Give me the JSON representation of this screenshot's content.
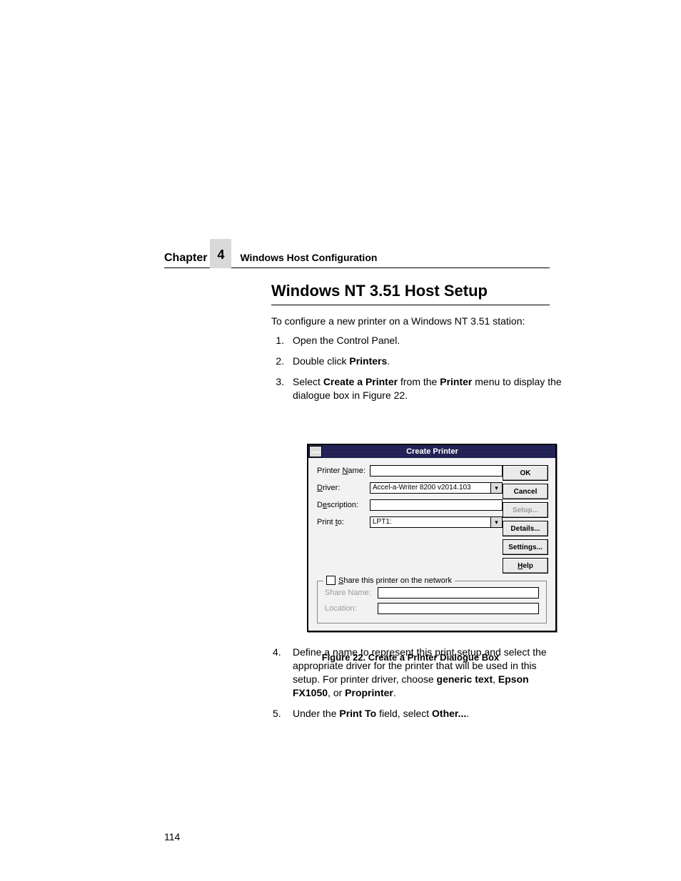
{
  "header": {
    "chapter_label": "Chapter",
    "chapter_number": "4",
    "chapter_title": "Windows Host Configuration"
  },
  "section_heading": "Windows NT 3.51 Host Setup",
  "intro": "To configure a new printer on a Windows NT 3.51 station:",
  "steps_a": {
    "s1": "Open the Control Panel.",
    "s2_pre": "Double click ",
    "s2_b": "Printers",
    "s2_post": ".",
    "s3_pre": "Select ",
    "s3_b1": "Create a Printer",
    "s3_mid": " from the ",
    "s3_b2": "Printer",
    "s3_post": " menu to display the dialogue box in Figure 22."
  },
  "dialog": {
    "title": "Create Printer",
    "labels": {
      "printer_name_pre": "Printer ",
      "printer_name_u": "N",
      "printer_name_post": "ame:",
      "driver_u": "D",
      "driver_post": "river:",
      "description_pre": "D",
      "description_u": "e",
      "description_post": "scription:",
      "print_to_pre": "Print ",
      "print_to_u": "t",
      "print_to_post": "o:"
    },
    "values": {
      "printer_name": "",
      "driver": "Accel-a-Writer 8200 v2014.103",
      "description": "",
      "print_to": "LPT1:"
    },
    "share": {
      "label_u": "S",
      "label_post": "hare this printer on the network",
      "share_name_label": "Share Name:",
      "location_u": "L",
      "location_post": "ocation:",
      "share_name_value": "",
      "location_value": ""
    },
    "buttons": {
      "ok": "OK",
      "cancel": "Cancel",
      "setup": "Setup...",
      "details": "Details...",
      "settings": "Settings...",
      "help_u": "H",
      "help_post": "elp"
    }
  },
  "figure_caption": "Figure 22. Create a Printer Dialogue Box",
  "steps_b": {
    "s4_pre": "Define a name to represent this print setup and select the appropriate driver for the printer that will be used in this setup. For printer driver, choose ",
    "s4_b1": "generic text",
    "s4_m1": ", ",
    "s4_b2": "Epson FX1050",
    "s4_m2": ", or ",
    "s4_b3": "Proprinter",
    "s4_post": ".",
    "s5_pre": "Under the ",
    "s5_b1": "Print To",
    "s5_mid": " field, select ",
    "s5_b2": "Other...",
    "s5_post": "."
  },
  "page_number": "114"
}
